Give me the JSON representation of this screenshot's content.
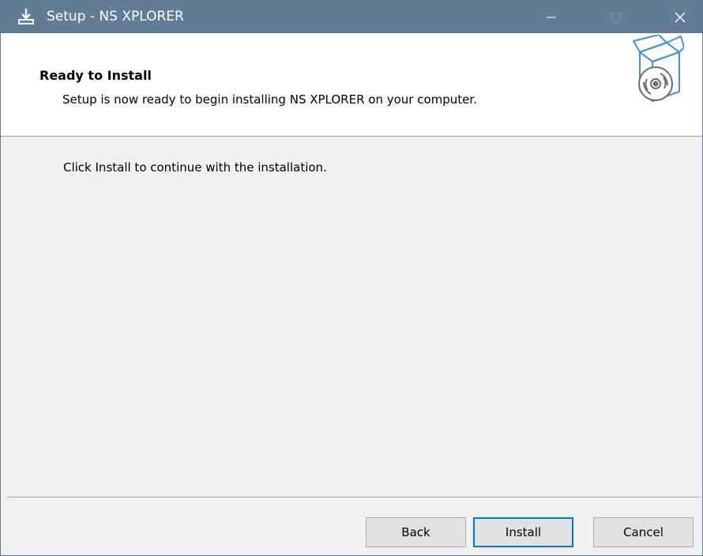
{
  "window": {
    "title": "Setup - NS XPLORER",
    "titlebar_color": "#617c94",
    "app_icon": "installer-download-icon",
    "controls": {
      "minimize_icon": "minimize-icon",
      "maximize_icon": "maximize-icon",
      "close_icon": "close-icon"
    }
  },
  "header": {
    "title": "Ready to Install",
    "subtitle": "Setup is now ready to begin installing NS XPLORER on your computer.",
    "icon": "software-box-cd-icon"
  },
  "body": {
    "message": "Click Install to continue with the installation."
  },
  "buttons": {
    "back": "Back",
    "install": "Install",
    "cancel": "Cancel",
    "default_accent": "#0078d7"
  }
}
